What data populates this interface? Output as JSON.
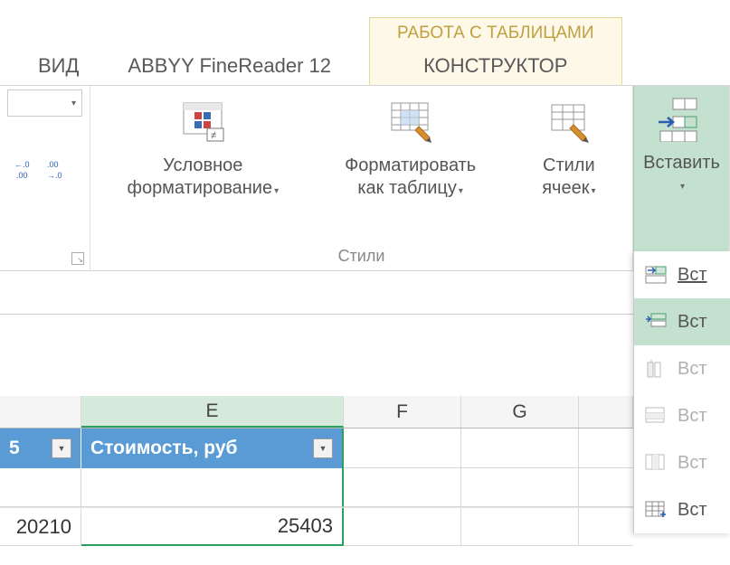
{
  "tabs": {
    "view": "ВИД",
    "abbr": "ABBYY FineReader 12",
    "context_group": "РАБОТА С ТАБЛИЦАМИ",
    "context_tab": "КОНСТРУКТОР"
  },
  "ribbon": {
    "number_group": {
      "label": ""
    },
    "styles_group": {
      "label": "Стили",
      "conditional_formatting_l1": "Условное",
      "conditional_formatting_l2": "форматирование",
      "format_as_table_l1": "Форматировать",
      "format_as_table_l2": "как таблицу",
      "cell_styles_l1": "Стили",
      "cell_styles_l2": "ячеек"
    },
    "insert_group": {
      "insert_label": "Вставить"
    }
  },
  "insert_menu": {
    "item1": "Вст",
    "item2": "Вст",
    "item3": "Вст",
    "item4": "Вст",
    "item5": "Вст",
    "item6": "Вст"
  },
  "sheet": {
    "columns": {
      "e": "E",
      "f": "F",
      "g": "G"
    },
    "table_header_d_partial": "",
    "table_header_e": "Стоимость, руб",
    "row1": {
      "d_partial": "20210",
      "e": "25403"
    },
    "partial_d_header_number": "5"
  },
  "colors": {
    "accent_green": "#c4e0ce",
    "table_header_blue": "#5a9bd5",
    "context_tab_bg": "#fdf8e8"
  }
}
